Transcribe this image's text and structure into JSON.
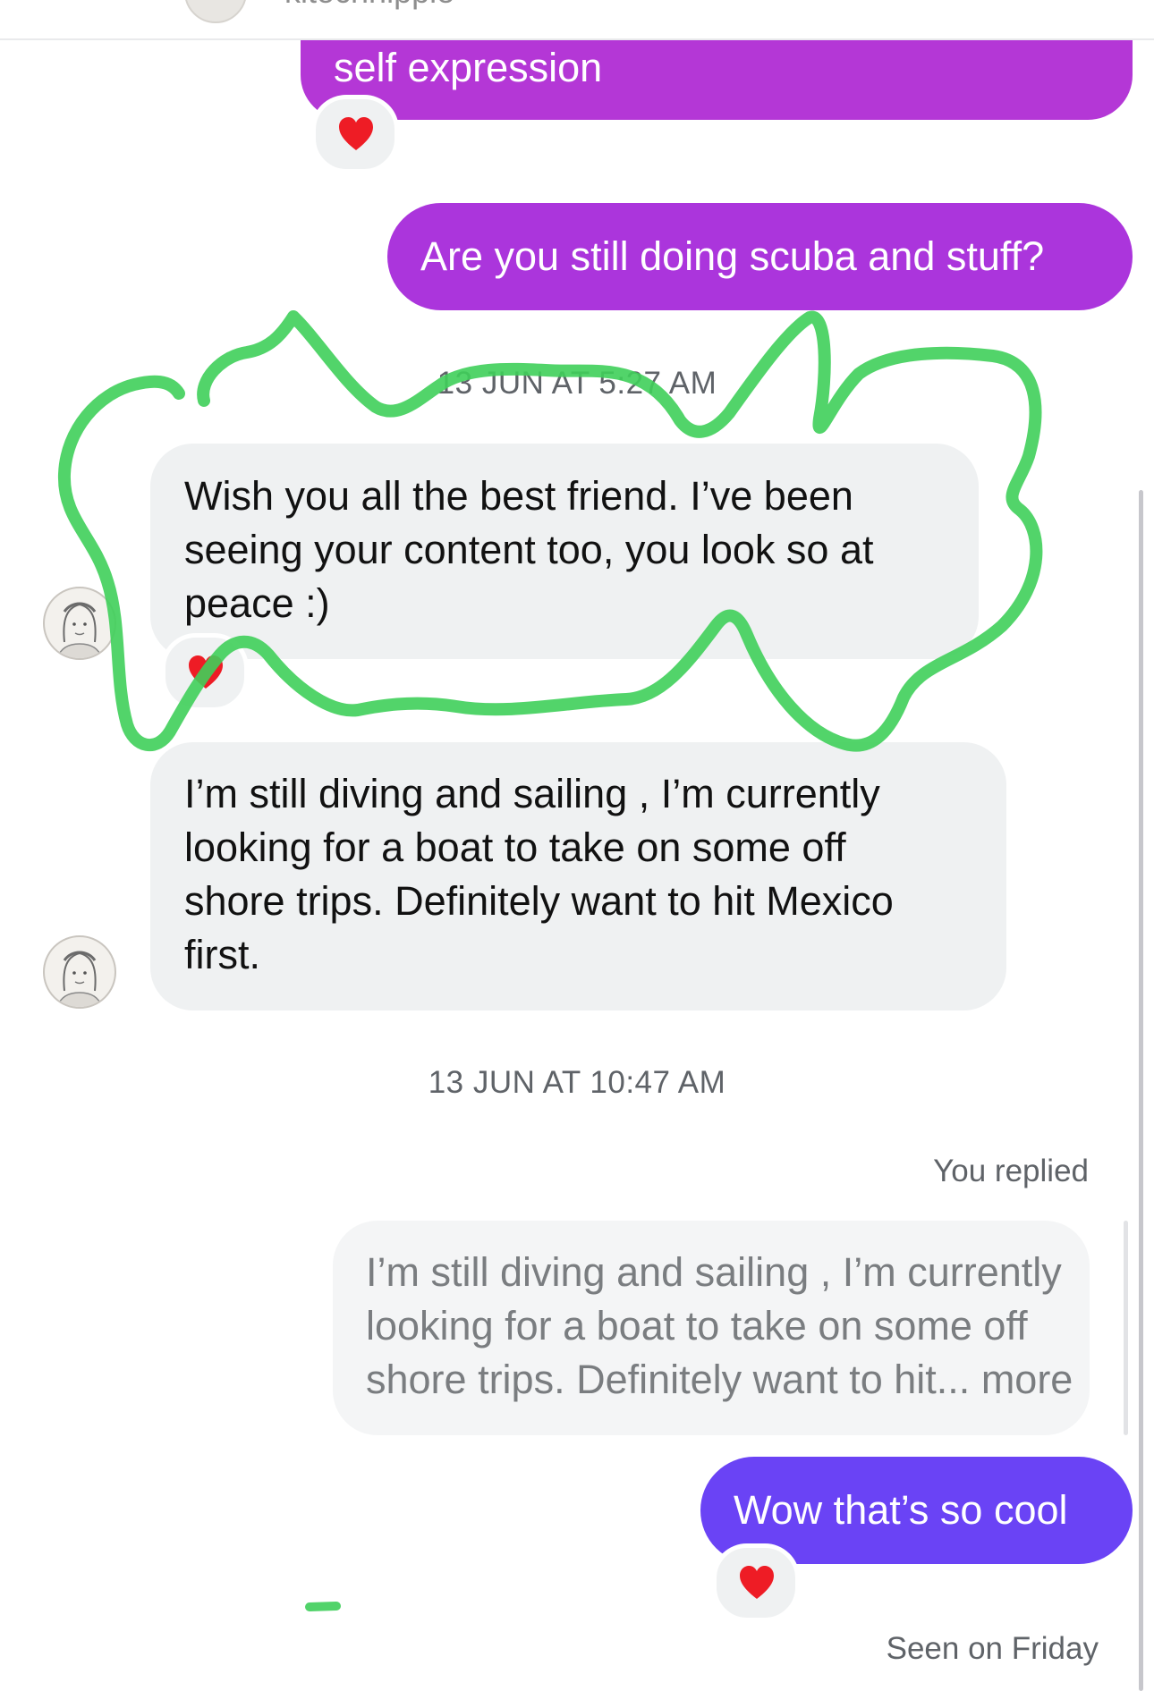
{
  "header": {
    "username": "kitochhippie"
  },
  "messages": {
    "out_1": {
      "text": "self expression",
      "reaction": "❤️",
      "color": "#b437d6"
    },
    "out_2": {
      "text": "Are you still doing scuba and stuff?",
      "color": "#ab35dc"
    },
    "timestamp_1": "13 JUN AT 5:27 AM",
    "in_1": {
      "lines": [
        "Wish you all the best friend. I’ve been",
        "seeing your content too, you look so at",
        "peace :)"
      ],
      "reaction": "❤️"
    },
    "in_2": {
      "lines": [
        "I’m still diving and sailing , I’m currently",
        "looking for a boat to take on some off",
        "shore trips. Definitely want to hit Mexico",
        "first."
      ]
    },
    "timestamp_2": "13 JUN AT 10:47 AM",
    "reply_label": "You replied",
    "quoted": {
      "lines": [
        "I’m still diving and sailing , I’m currently",
        "looking for a boat to take on some off"
      ],
      "last_line": "shore trips. Definitely want to hit...",
      "more": "more"
    },
    "out_3": {
      "text": "Wow that’s so cool",
      "reaction": "❤️",
      "color": "#6a43f5"
    }
  },
  "status": {
    "seen": "Seen on Friday"
  },
  "colors": {
    "annotation_green": "#3fcf5a",
    "incoming_bubble": "#eff1f2",
    "meta_text": "#5f6368"
  },
  "icons": {
    "reaction": "red-heart-icon",
    "avatar": "contact-avatar-sketch"
  }
}
